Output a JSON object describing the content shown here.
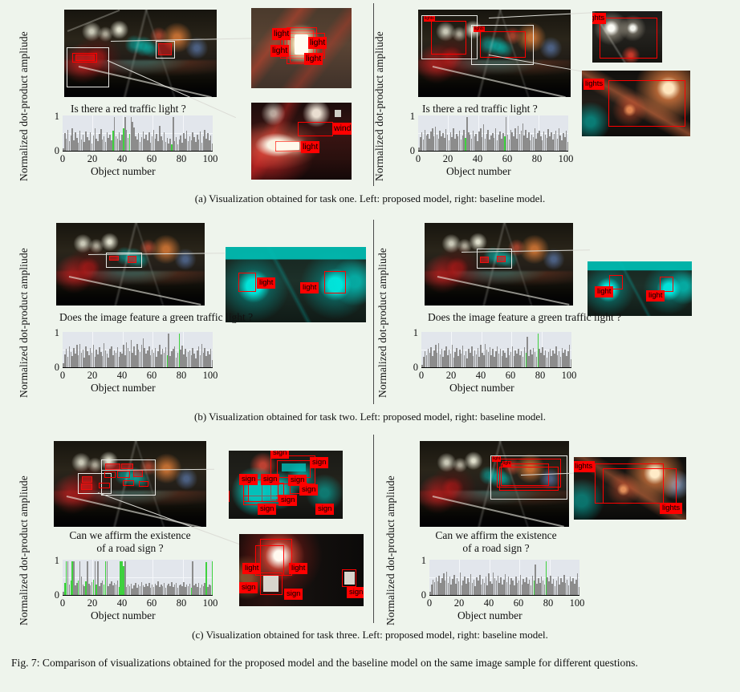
{
  "figure": {
    "caption": "Fig. 7: Comparison of visualizations obtained for the proposed model and the baseline model on the same image sample for different questions.",
    "subcaptions": {
      "a": "(a) Visualization obtained for task one. Left: proposed model, right: baseline model.",
      "b": "(b) Visualization obtained for task two. Left: proposed model, right: baseline model.",
      "c": "(c) Visualization obtained for task three. Left: proposed model, right: baseline model."
    }
  },
  "axes": {
    "ylabel": "Normalized dot-product ampliude",
    "xlabel": "Object number",
    "yticks": [
      "0",
      "1"
    ],
    "xticks": [
      "0",
      "20",
      "40",
      "60",
      "80",
      "100"
    ]
  },
  "colors": {
    "bar_gray": "#8c8c8c",
    "bar_green": "#3fd13f",
    "box_red": "#ff0000",
    "box_white": "#e8e8e4",
    "plot_bg": "#e2e6ec",
    "page_bg": "#eef4ec"
  },
  "rows": [
    {
      "id": "task-one",
      "question": "Is there a red traffic light ?",
      "left": {
        "model": "proposed",
        "crops": [
          {
            "id": "traffic-light-crop",
            "labels": [
              "light",
              "light",
              "light",
              "light"
            ]
          },
          {
            "id": "car-windshield-crop",
            "labels": [
              "windshield",
              "light"
            ]
          }
        ]
      },
      "right": {
        "model": "baseline",
        "crops": [
          {
            "id": "streetlights-crop",
            "labels": [
              "lights"
            ]
          },
          {
            "id": "glare-crop",
            "labels": [
              "lights"
            ]
          }
        ],
        "inline_labels": [
          "lights",
          "lights"
        ]
      }
    },
    {
      "id": "task-two",
      "question": "Does the image feature a green traffic light ?",
      "left": {
        "model": "proposed",
        "crops": [
          {
            "id": "green-lights-crop",
            "labels": [
              "light",
              "light"
            ]
          }
        ]
      },
      "right": {
        "model": "baseline",
        "crops": [
          {
            "id": "green-lights-crop",
            "labels": [
              "light",
              "light"
            ]
          }
        ]
      }
    },
    {
      "id": "task-three",
      "question_line1": "Can we affirm the existence",
      "question_line2": "of a road sign ?",
      "left": {
        "model": "proposed",
        "crops": [
          {
            "id": "signs-crop",
            "labels": [
              "sign",
              "sign",
              "sign",
              "sign",
              "sign",
              "sign",
              "sign",
              "sign",
              "sign",
              "sign"
            ]
          },
          {
            "id": "dark-sign-crop",
            "labels": [
              "light",
              "light",
              "sign",
              "sign",
              "sign"
            ]
          }
        ]
      },
      "right": {
        "model": "baseline",
        "crops": [
          {
            "id": "lights-pair-crop",
            "labels": [
              "lights",
              "lights"
            ]
          }
        ],
        "inline_labels": [
          "light",
          "light"
        ]
      }
    }
  ],
  "chart_data": [
    {
      "id": "chart-a-left",
      "type": "bar",
      "title": "Is there a red traffic light ?",
      "xlabel": "Object number",
      "ylabel": "Normalized dot-product ampliude",
      "xlim": [
        0,
        100
      ],
      "ylim": [
        0,
        1.05
      ],
      "grid": true,
      "highlight_color": "#3fd13f",
      "base_color": "#8c8c8c",
      "highlight_indices": [
        34,
        41,
        45,
        73
      ],
      "values": [
        0.07,
        0.52,
        0.35,
        0.62,
        0.28,
        0.46,
        0.67,
        0.3,
        0.55,
        0.38,
        0.24,
        0.6,
        0.33,
        0.48,
        0.26,
        0.58,
        0.41,
        0.31,
        0.54,
        0.22,
        0.45,
        0.66,
        0.37,
        0.29,
        0.51,
        0.64,
        0.34,
        0.43,
        0.27,
        0.56,
        0.39,
        0.48,
        0.32,
        0.59,
        1.0,
        0.42,
        0.36,
        0.55,
        0.3,
        0.47,
        0.66,
        1.0,
        0.63,
        0.38,
        0.5,
        1.0,
        0.86,
        0.7,
        0.44,
        0.33,
        0.52,
        0.26,
        0.41,
        0.58,
        0.35,
        0.47,
        0.3,
        0.55,
        0.23,
        0.42,
        0.61,
        0.36,
        0.49,
        0.28,
        0.73,
        0.44,
        0.31,
        0.54,
        0.27,
        0.38,
        0.22,
        0.35,
        0.2,
        1.0,
        0.29,
        0.4,
        0.18,
        0.33,
        0.46,
        0.25,
        0.52,
        0.37,
        0.6,
        0.29,
        0.44,
        0.31,
        0.56,
        0.4,
        0.27,
        0.48,
        0.34,
        0.58,
        0.25,
        0.43,
        0.62,
        0.36,
        0.53,
        0.3,
        0.45,
        0.22
      ]
    },
    {
      "id": "chart-a-right",
      "type": "bar",
      "title": "Is there a red traffic light ?",
      "xlabel": "Object number",
      "ylabel": "Normalized dot-product ampliude",
      "xlim": [
        0,
        100
      ],
      "ylim": [
        0,
        1.05
      ],
      "grid": true,
      "highlight_color": "#3fd13f",
      "base_color": "#8c8c8c",
      "highlight_indices": [
        32,
        58
      ],
      "values": [
        0.1,
        0.4,
        0.55,
        0.33,
        0.62,
        0.45,
        0.5,
        0.37,
        0.58,
        0.66,
        0.42,
        0.71,
        0.48,
        0.35,
        0.6,
        0.44,
        0.52,
        0.38,
        0.64,
        0.47,
        0.3,
        0.56,
        0.41,
        0.68,
        0.35,
        0.5,
        0.44,
        0.59,
        0.33,
        0.46,
        0.62,
        0.38,
        1.0,
        0.54,
        0.47,
        0.35,
        0.6,
        0.43,
        0.51,
        0.29,
        0.57,
        0.66,
        0.4,
        0.78,
        0.36,
        0.49,
        0.61,
        0.34,
        0.45,
        0.53,
        0.39,
        0.66,
        0.3,
        0.47,
        0.58,
        0.36,
        0.52,
        0.44,
        1.0,
        0.48,
        0.33,
        0.61,
        0.55,
        0.42,
        0.68,
        0.36,
        0.74,
        0.5,
        0.59,
        0.81,
        0.45,
        0.63,
        0.38,
        0.56,
        0.3,
        0.48,
        0.41,
        0.66,
        0.35,
        0.52,
        0.6,
        0.44,
        0.31,
        0.58,
        0.47,
        0.38,
        0.64,
        0.42,
        0.55,
        0.33,
        0.49,
        0.6,
        0.37,
        0.68,
        0.45,
        0.31,
        0.53,
        0.4,
        0.59,
        0.27
      ]
    },
    {
      "id": "chart-b-left",
      "type": "bar",
      "title": "Does the image feature a green traffic light ?",
      "xlabel": "Object number",
      "ylabel": "Normalized dot-product ampliude",
      "xlim": [
        0,
        100
      ],
      "ylim": [
        0,
        1.05
      ],
      "grid": true,
      "highlight_color": "#3fd13f",
      "base_color": "#8c8c8c",
      "highlight_indices": [
        70,
        78
      ],
      "values": [
        0.12,
        0.38,
        0.55,
        0.3,
        0.62,
        0.45,
        0.33,
        0.58,
        0.4,
        0.66,
        0.36,
        0.7,
        0.44,
        0.52,
        0.29,
        0.61,
        0.47,
        0.35,
        0.57,
        0.42,
        0.66,
        0.31,
        0.53,
        0.38,
        0.6,
        0.46,
        0.34,
        0.72,
        0.49,
        0.41,
        0.28,
        0.56,
        0.63,
        0.37,
        0.5,
        0.44,
        0.59,
        0.32,
        0.46,
        0.4,
        0.67,
        0.35,
        0.74,
        0.58,
        0.48,
        0.82,
        0.42,
        0.61,
        0.36,
        0.7,
        0.53,
        0.45,
        0.66,
        0.87,
        0.58,
        0.4,
        0.49,
        0.63,
        0.35,
        0.52,
        0.44,
        0.57,
        0.31,
        0.48,
        0.66,
        0.38,
        0.55,
        0.42,
        0.6,
        0.36,
        1.0,
        0.33,
        0.47,
        0.55,
        0.62,
        0.28,
        0.44,
        1.0,
        0.52,
        0.64,
        0.38,
        0.56,
        0.3,
        0.45,
        0.49,
        0.35,
        0.58,
        0.41,
        0.27,
        0.5,
        0.61,
        0.36,
        0.7,
        0.44,
        0.58,
        0.33,
        0.47,
        0.39,
        0.55,
        0.22
      ]
    },
    {
      "id": "chart-b-right",
      "type": "bar",
      "title": "Does the image feature a green traffic light ?",
      "xlabel": "Object number",
      "ylabel": "Normalized dot-product ampliude",
      "xlim": [
        0,
        100
      ],
      "ylim": [
        0,
        1.05
      ],
      "grid": true,
      "highlight_color": "#3fd13f",
      "base_color": "#8c8c8c",
      "highlight_indices": [
        70,
        78
      ],
      "values": [
        0.08,
        0.3,
        0.48,
        0.36,
        0.55,
        0.42,
        0.6,
        0.33,
        0.5,
        0.66,
        0.44,
        0.72,
        0.38,
        0.56,
        0.31,
        0.49,
        0.62,
        0.35,
        0.53,
        0.41,
        0.68,
        0.29,
        0.46,
        0.58,
        0.34,
        0.52,
        0.4,
        0.64,
        0.36,
        0.47,
        0.27,
        0.55,
        0.44,
        0.61,
        0.33,
        0.5,
        0.38,
        0.57,
        0.3,
        0.66,
        0.42,
        0.35,
        0.7,
        0.52,
        0.45,
        0.6,
        0.37,
        0.54,
        0.31,
        0.48,
        0.63,
        0.4,
        0.56,
        0.34,
        0.51,
        0.44,
        0.29,
        0.58,
        0.37,
        0.46,
        0.62,
        0.33,
        0.5,
        0.41,
        0.55,
        0.36,
        0.48,
        0.3,
        0.6,
        0.44,
        0.9,
        0.34,
        0.52,
        0.38,
        0.57,
        0.46,
        0.31,
        1.0,
        0.54,
        0.42,
        0.6,
        0.35,
        0.49,
        0.28,
        0.45,
        0.56,
        0.33,
        0.51,
        0.4,
        0.62,
        0.36,
        0.47,
        0.3,
        0.58,
        0.43,
        0.52,
        0.34,
        0.48,
        0.66,
        0.25
      ]
    },
    {
      "id": "chart-c-left",
      "type": "bar",
      "title": "Can we affirm the existence of a road sign ?",
      "xlabel": "Object number",
      "ylabel": "Normalized dot-product ampliude",
      "xlim": [
        0,
        100
      ],
      "ylim": [
        0,
        1.05
      ],
      "grid": true,
      "highlight_color": "#3fd13f",
      "base_color": "#8c8c8c",
      "highlight_indices": [
        2,
        3,
        6,
        7,
        11,
        16,
        21,
        23,
        28,
        29,
        38,
        39,
        40,
        41,
        86,
        96,
        100
      ],
      "values": [
        0.1,
        0.35,
        1.0,
        1.0,
        0.3,
        0.42,
        1.0,
        1.0,
        0.28,
        0.36,
        0.44,
        1.0,
        0.55,
        0.32,
        0.26,
        0.4,
        1.0,
        0.34,
        0.29,
        0.38,
        0.46,
        1.0,
        0.31,
        1.0,
        0.27,
        0.35,
        0.42,
        0.3,
        1.0,
        1.0,
        0.26,
        0.33,
        0.4,
        0.28,
        0.36,
        0.3,
        0.44,
        0.25,
        1.0,
        1.0,
        0.85,
        1.0,
        0.24,
        0.3,
        0.26,
        0.33,
        0.2,
        0.28,
        0.35,
        0.22,
        0.31,
        0.26,
        0.38,
        0.29,
        0.24,
        0.33,
        0.27,
        0.36,
        0.22,
        0.3,
        0.25,
        0.34,
        0.28,
        0.4,
        0.23,
        0.31,
        0.27,
        0.36,
        0.21,
        0.29,
        0.33,
        0.26,
        0.38,
        0.24,
        0.3,
        0.35,
        0.22,
        0.28,
        0.32,
        0.26,
        0.39,
        0.23,
        0.3,
        0.27,
        0.34,
        0.21,
        1.0,
        0.28,
        0.33,
        0.25,
        0.37,
        0.22,
        0.3,
        0.26,
        0.35,
        0.98,
        0.24,
        0.31,
        0.28,
        1.0
      ]
    },
    {
      "id": "chart-c-right",
      "type": "bar",
      "title": "Can we affirm the existence of a road sign ?",
      "xlabel": "Object number",
      "ylabel": "Normalized dot-product ampliude",
      "xlim": [
        0,
        100
      ],
      "ylim": [
        0,
        1.05
      ],
      "grid": true,
      "highlight_color": "#3fd13f",
      "base_color": "#8c8c8c",
      "highlight_indices": [
        70,
        78
      ],
      "values": [
        0.09,
        0.32,
        0.46,
        0.38,
        0.52,
        0.41,
        0.58,
        0.35,
        0.49,
        0.64,
        0.42,
        0.7,
        0.36,
        0.54,
        0.3,
        0.47,
        0.6,
        0.34,
        0.51,
        0.4,
        0.66,
        0.28,
        0.44,
        0.56,
        0.33,
        0.5,
        0.38,
        0.62,
        0.35,
        0.45,
        0.26,
        0.53,
        0.42,
        0.59,
        0.31,
        0.48,
        0.36,
        0.55,
        0.29,
        0.64,
        0.4,
        0.34,
        0.68,
        0.5,
        0.43,
        0.58,
        0.35,
        0.52,
        0.3,
        0.46,
        0.61,
        0.38,
        0.54,
        0.32,
        0.49,
        0.42,
        0.28,
        0.56,
        0.35,
        0.44,
        0.6,
        0.31,
        0.48,
        0.39,
        0.53,
        0.34,
        0.46,
        0.29,
        0.58,
        0.42,
        0.9,
        0.33,
        0.5,
        0.36,
        0.55,
        0.44,
        0.3,
        1.0,
        0.52,
        0.4,
        0.58,
        0.34,
        0.47,
        0.27,
        0.43,
        0.54,
        0.32,
        0.49,
        0.38,
        0.6,
        0.35,
        0.45,
        0.29,
        0.56,
        0.41,
        0.5,
        0.33,
        0.46,
        0.64,
        0.24
      ]
    }
  ]
}
